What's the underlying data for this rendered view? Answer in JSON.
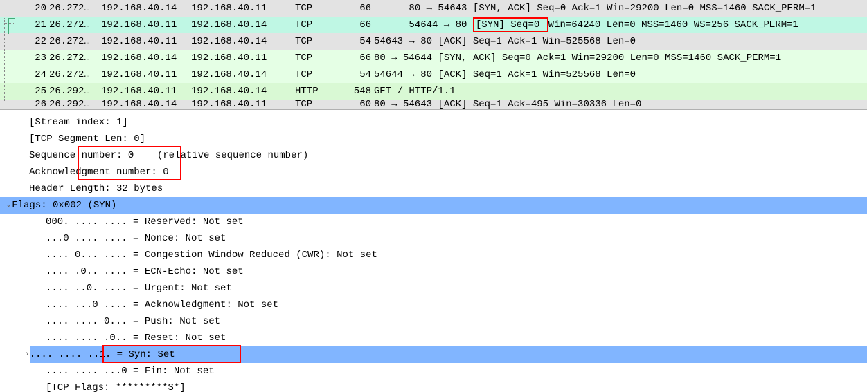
{
  "packets": [
    {
      "no": "20",
      "time": "26.272…",
      "src": "192.168.40.14",
      "dst": "192.168.40.11",
      "proto": "TCP",
      "len": "66",
      "info_pre": "80 → 54643 ",
      "info_hl": "[SYN, ACK]",
      "info_post": " Seq=0 Ack=1 Win=29200 Len=0 MSS=1460 SACK_PERM=1",
      "cls": "row-gray"
    },
    {
      "no": "21",
      "time": "26.272…",
      "src": "192.168.40.11",
      "dst": "192.168.40.14",
      "proto": "TCP",
      "len": "66",
      "info_pre": "54644 → 80 ",
      "info_hl": "[SYN] Seq=0 ",
      "info_post": "Win=64240 Len=0 MSS=1460 WS=256 SACK_PERM=1",
      "cls": "row-sel"
    },
    {
      "no": "22",
      "time": "26.272…",
      "src": "192.168.40.11",
      "dst": "192.168.40.14",
      "proto": "TCP",
      "len": "54",
      "info_pre": "54643 → 80 [ACK] Seq=1 Ack=1 Win=525568 Len=0",
      "info_hl": "",
      "info_post": "",
      "cls": "row-gray"
    },
    {
      "no": "23",
      "time": "26.272…",
      "src": "192.168.40.14",
      "dst": "192.168.40.11",
      "proto": "TCP",
      "len": "66",
      "info_pre": "80 → 54644 [SYN, ACK] Seq=0 Ack=1 Win=29200 Len=0 MSS=1460 SACK_PERM=1",
      "info_hl": "",
      "info_post": "",
      "cls": "row-green"
    },
    {
      "no": "24",
      "time": "26.272…",
      "src": "192.168.40.11",
      "dst": "192.168.40.14",
      "proto": "TCP",
      "len": "54",
      "info_pre": "54644 → 80 [ACK] Seq=1 Ack=1 Win=525568 Len=0",
      "info_hl": "",
      "info_post": "",
      "cls": "row-green"
    },
    {
      "no": "25",
      "time": "26.292…",
      "src": "192.168.40.11",
      "dst": "192.168.40.14",
      "proto": "HTTP",
      "len": "548",
      "info_pre": "GET / HTTP/1.1",
      "info_hl": "",
      "info_post": "",
      "cls": "row-http"
    },
    {
      "no": "26",
      "time": "26.292…",
      "src": "192.168.40.14",
      "dst": "192.168.40.11",
      "proto": "TCP",
      "len": "60",
      "info_pre": "80 → 54643 [ACK] Seq=1 Ack=495 Win=30336 Len=0",
      "info_hl": "",
      "info_post": "",
      "cls": "row-gray row-clip"
    }
  ],
  "details": {
    "stream": "[Stream index: 1]",
    "seglen": "[TCP Segment Len: 0]",
    "seq_pre": "Sequence ",
    "seq_box": "number: 0    (re",
    "seq_post": "lative sequence number)",
    "ack_pre": "Acknowle",
    "ack_box": "dgment number: 0",
    "hdr": "Header Length: 32 bytes",
    "flags": "Flags: 0x002 (SYN)",
    "reserved": "000. .... .... = Reserved: Not set",
    "nonce": "...0 .... .... = Nonce: Not set",
    "cwr": ".... 0... .... = Congestion Window Reduced (CWR): Not set",
    "ecn": ".... .0.. .... = ECN-Echo: Not set",
    "urg": ".... ..0. .... = Urgent: Not set",
    "ackf": ".... ...0 .... = Acknowledgment: Not set",
    "push": ".... .... 0... = Push: Not set",
    "reset": ".... .... .0.. = Reset: Not set",
    "syn_pre": ".... .... .",
    "syn_box": ".1. = Syn: Set",
    "fin": ".... .... ...0 = Fin: Not set",
    "tcpflags": "[TCP Flags: *********S*]"
  }
}
